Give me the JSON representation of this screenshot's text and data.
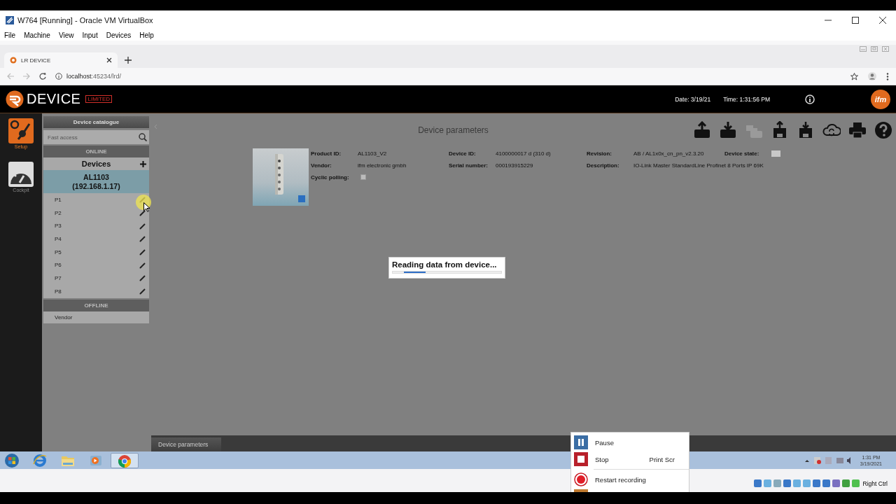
{
  "window": {
    "title": "W764 [Running] - Oracle VM VirtualBox"
  },
  "menu": [
    "File",
    "Machine",
    "View",
    "Input",
    "Devices",
    "Help"
  ],
  "browser": {
    "tab": "LR DEVICE",
    "url_host": "localhost",
    "url_rest": ":45234/lrd/"
  },
  "app": {
    "logo": "DEVICE",
    "edition": "LIMITED",
    "date": "Date: 3/19/21",
    "time": "Time: 1:31:56 PM",
    "brand": "ifm"
  },
  "rail": [
    {
      "kind": "setup",
      "label": "Setup",
      "selected": true
    },
    {
      "kind": "cockpit",
      "label": "Cockpit",
      "selected": false
    }
  ],
  "catalogue": {
    "title": "Device catalogue",
    "search": {
      "placeholder": "Fast access"
    },
    "online": "ONLINE",
    "devices": "Devices",
    "device": {
      "name": "AL1103",
      "address": "(192.168.1.17)",
      "selected": true
    },
    "ports": [
      "P1",
      "P2",
      "P3",
      "P4",
      "P5",
      "P6",
      "P7",
      "P8"
    ],
    "offline": "OFFLINE",
    "offline_items": [
      "Vendor"
    ]
  },
  "main": {
    "title": "Device parameters",
    "toolbar": [
      {
        "kind": "upload",
        "disabled": false
      },
      {
        "kind": "download",
        "disabled": false
      },
      {
        "kind": "multi",
        "disabled": true
      },
      {
        "kind": "save-up",
        "disabled": false
      },
      {
        "kind": "save-down",
        "disabled": false
      },
      {
        "kind": "cloud",
        "disabled": false
      },
      {
        "kind": "print",
        "disabled": false
      },
      {
        "kind": "help",
        "disabled": false
      }
    ],
    "rows": [
      [
        {
          "kind": "text",
          "label": "Product ID:",
          "value": "AL1103_V2"
        },
        {
          "kind": "text",
          "label": "Device ID:",
          "value": "4100000017 d (310 d)"
        },
        {
          "kind": "text",
          "label": "Revision:",
          "value": "AB / AL1x0x_cn_pn_v2.3.20"
        },
        {
          "kind": "state",
          "label": "Device state:"
        }
      ],
      [
        {
          "kind": "text",
          "label": "Vendor:",
          "value": "ifm electronic gmbh"
        },
        {
          "kind": "text",
          "label": "Serial number:",
          "value": "000193915229"
        },
        {
          "kind": "text",
          "label": "Description:",
          "value": "IO-Link Master StandardLine Profinet 8 Ports IP 69K"
        }
      ],
      [
        {
          "kind": "checkbox",
          "label": "Cyclic polling:",
          "checked": false
        }
      ]
    ]
  },
  "dialog": {
    "message": "Reading data from device..."
  },
  "bottom_tabs": [
    {
      "label": "Device parameters",
      "selected": true
    }
  ],
  "taskbar": {
    "apps": [
      {
        "kind": "start",
        "selected": false
      },
      {
        "kind": "ie",
        "selected": false
      },
      {
        "kind": "folder",
        "selected": false
      },
      {
        "kind": "media",
        "selected": false
      },
      {
        "kind": "chrome",
        "selected": true
      }
    ],
    "clock_time": "1:31 PM",
    "clock_date": "3/19/2021"
  },
  "recording_menu": [
    {
      "kind": "pause",
      "label": "Pause"
    },
    {
      "kind": "stop",
      "label": "Stop",
      "shortcut": "Print Scr"
    },
    {
      "kind": "restart",
      "label": "Restart recording"
    },
    {
      "kind": "exit"
    }
  ],
  "status_bar": {
    "host_key": "Right Ctrl"
  }
}
